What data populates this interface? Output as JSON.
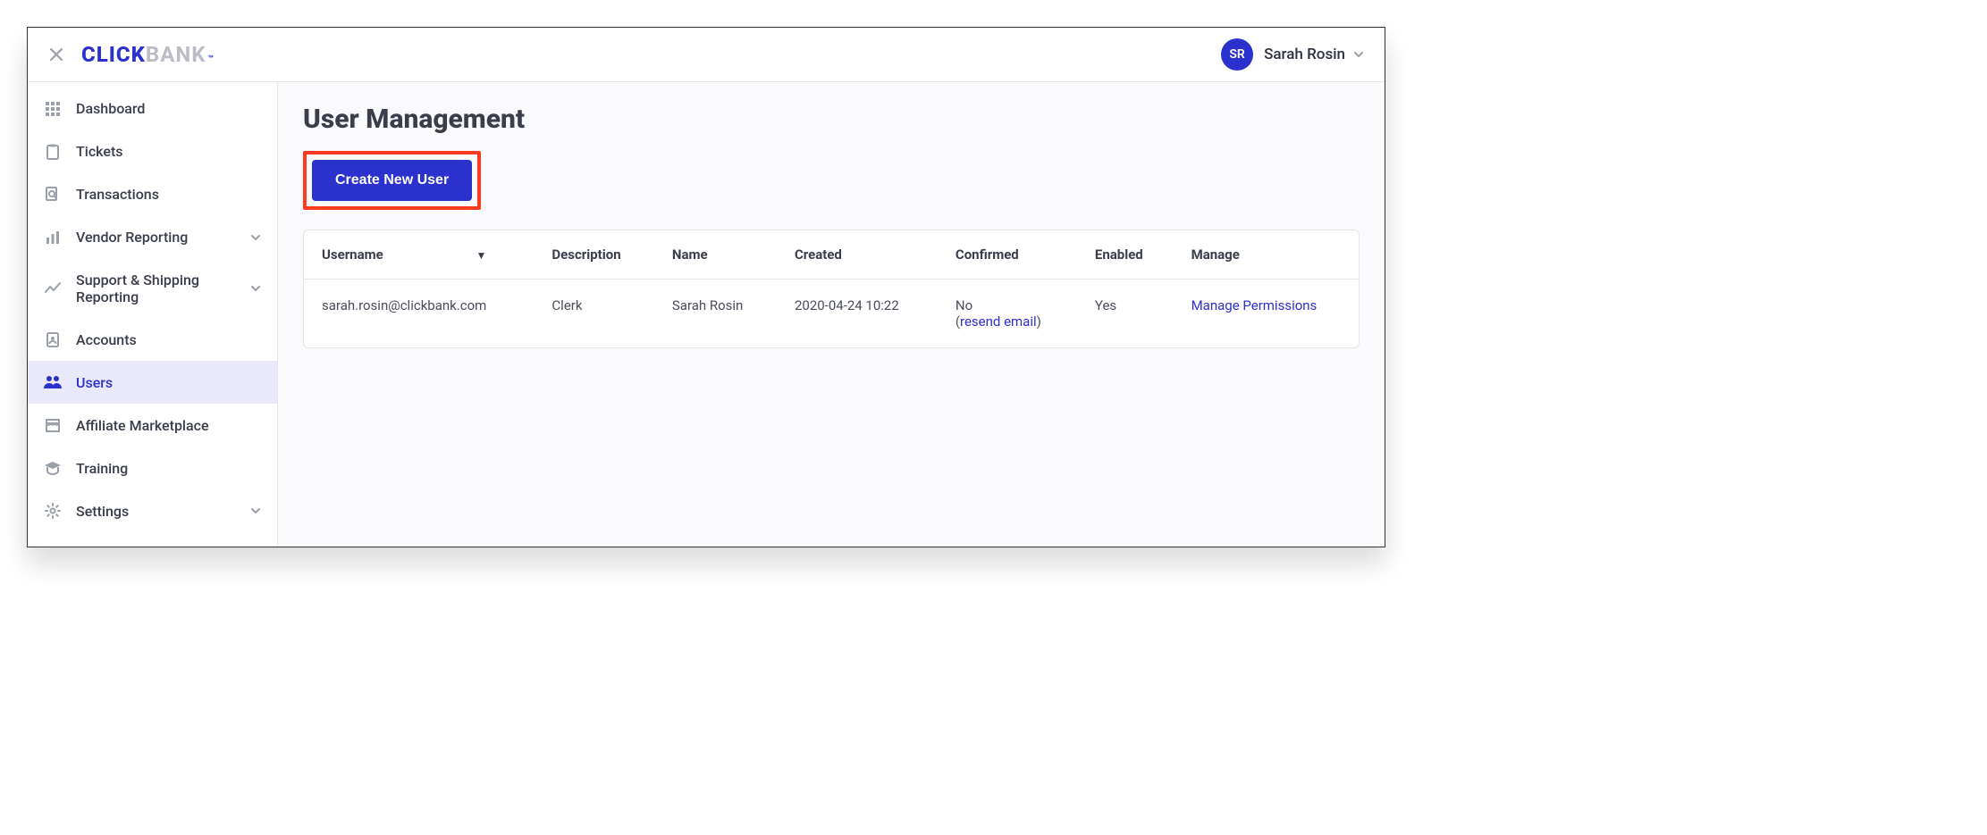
{
  "header": {
    "logo_click": "CLICK",
    "logo_bank": "BANK",
    "avatar_initials": "SR",
    "user_name": "Sarah Rosin"
  },
  "sidebar": {
    "items": [
      {
        "label": "Dashboard",
        "icon": "grid"
      },
      {
        "label": "Tickets",
        "icon": "clipboard"
      },
      {
        "label": "Transactions",
        "icon": "receipt"
      },
      {
        "label": "Vendor Reporting",
        "icon": "bar-chart",
        "expandable": true
      },
      {
        "label": "Support & Shipping Reporting",
        "icon": "trend",
        "expandable": true
      },
      {
        "label": "Accounts",
        "icon": "id-badge"
      },
      {
        "label": "Users",
        "icon": "users",
        "active": true
      },
      {
        "label": "Affiliate Marketplace",
        "icon": "store"
      },
      {
        "label": "Training",
        "icon": "grad-cap"
      },
      {
        "label": "Settings",
        "icon": "gear",
        "expandable": true
      }
    ]
  },
  "main": {
    "page_title": "User Management",
    "create_button": "Create New User",
    "table": {
      "headers": [
        "Username",
        "Description",
        "Name",
        "Created",
        "Confirmed",
        "Enabled",
        "Manage"
      ],
      "rows": [
        {
          "username": "sarah.rosin@clickbank.com",
          "description": "Clerk",
          "name": "Sarah Rosin",
          "created": "2020-04-24 10:22",
          "confirmed": "No",
          "resend_label": "resend email",
          "enabled": "Yes",
          "manage": "Manage Permissions"
        }
      ]
    }
  }
}
